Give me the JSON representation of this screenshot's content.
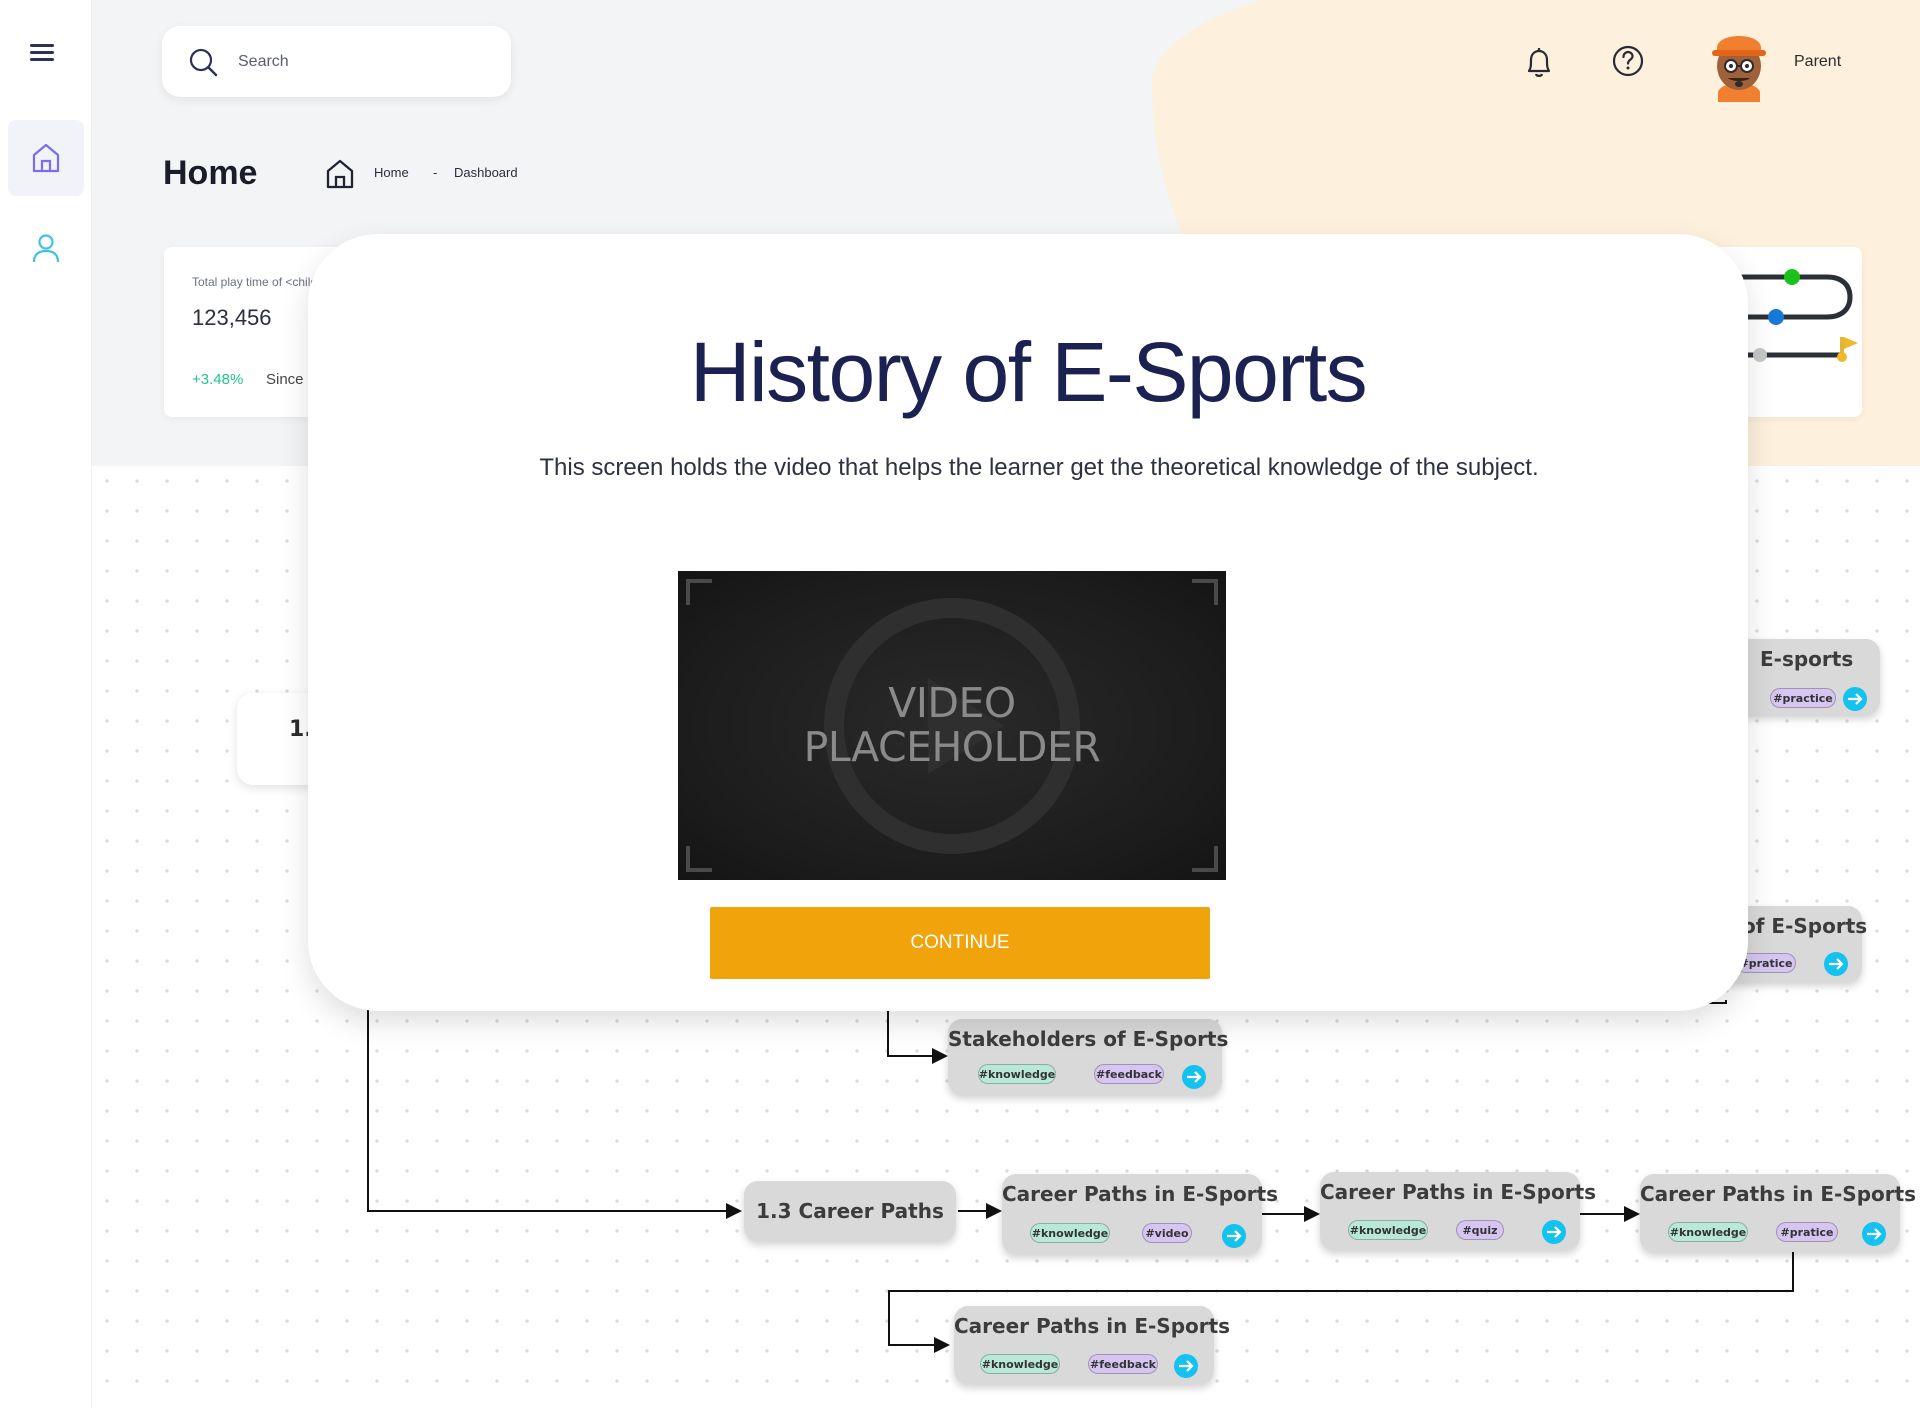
{
  "sidebar": {
    "menu_icon": "hamburger-icon",
    "items": [
      {
        "icon": "home-icon"
      },
      {
        "icon": "user-icon"
      }
    ]
  },
  "header": {
    "search": {
      "placeholder": "Search",
      "icon": "search-icon"
    },
    "notification_icon": "bell-icon",
    "help_icon": "help-circle-icon",
    "user": {
      "role": "Parent",
      "avatar": "avatar-icon"
    }
  },
  "page": {
    "title": "Home",
    "breadcrumb": {
      "home_icon": "home-icon",
      "home": "Home",
      "separator": "-",
      "current": "Dashboard"
    }
  },
  "stats": {
    "label": "Total play time of <child",
    "value": "123,456",
    "change": "+3.48%",
    "since": "Since"
  },
  "flow": {
    "partial_node": "1.",
    "nodes": {
      "esports_top": {
        "title": "E-sports",
        "tags": [
          "#practice"
        ]
      },
      "of_esports": {
        "title": "of E-Sports",
        "tags": [
          "#pratice"
        ]
      },
      "stakeholders": {
        "title": "Stakeholders of E-Sports",
        "tags": [
          "#knowledge",
          "#feedback"
        ]
      },
      "lesson_13": {
        "title": "1.3 Career Paths"
      },
      "career_1": {
        "title": "Career Paths in E-Sports",
        "tags": [
          "#knowledge",
          "#video"
        ]
      },
      "career_2": {
        "title": "Career Paths in E-Sports",
        "tags": [
          "#knowledge",
          "#quiz"
        ]
      },
      "career_3": {
        "title": "Career Paths in E-Sports",
        "tags": [
          "#knowledge",
          "#pratice"
        ]
      },
      "career_4": {
        "title": "Career Paths in E-Sports",
        "tags": [
          "#knowledge",
          "#feedback"
        ]
      }
    }
  },
  "modal": {
    "title": "History of E-Sports",
    "description": "This screen holds the video that helps the learner get the theoretical knowledge of the subject.",
    "video_text_line1": "VIDEO",
    "video_text_line2": "PLACEHOLDER",
    "continue_label": "CONTINUE"
  },
  "colors": {
    "accent": "#f0a30a",
    "title": "#1b2150",
    "go_button": "#13c2ee",
    "tag_knowledge": "#b9e8d8",
    "tag_other": "#d5c5f0"
  }
}
